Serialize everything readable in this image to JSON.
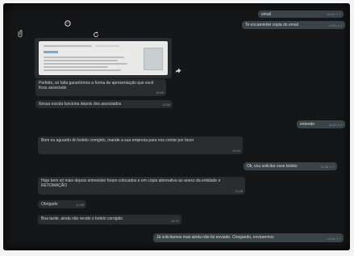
{
  "messages": [
    {
      "id": "m1",
      "side": "out",
      "text": "email",
      "time": "10:51",
      "ticks": "✓✓"
    },
    {
      "id": "m2",
      "side": "out",
      "text": "Te encaminhei cópia do email",
      "time": "10:51",
      "ticks": "✓✓"
    },
    {
      "id": "m4",
      "side": "in",
      "text": "Perfeito, só falta garantirmos a forma de apresentação que você ficou associado",
      "time": "10:56"
    },
    {
      "id": "m5",
      "side": "in",
      "text": "Nossa escola funciona depois dos associados",
      "time": "10:56"
    },
    {
      "id": "m6",
      "side": "out",
      "text": "entendo",
      "time": "11:01",
      "ticks": "✓✓"
    },
    {
      "id": "m7",
      "side": "in",
      "text": "Bom eu aguardo do boleto corrigido, mande a sua empresa para nos contar por favor",
      "time": "11:04"
    },
    {
      "id": "m8",
      "side": "out",
      "text": "Ok, vou solicitar esse boleto",
      "time": "11:05",
      "ticks": "✓✓"
    },
    {
      "id": "m9",
      "side": "in",
      "text": "Hoje bem só mais depois entrevistei foram colocados e em cópia alternativa ao anexo da entidade e RETOMAÇÃO",
      "time": "11:08"
    },
    {
      "id": "m10",
      "side": "in",
      "text": "Obrigado",
      "time": "11:08"
    },
    {
      "id": "m11",
      "side": "in",
      "text": "Boa tarde, ainda não recebi o boleto corrigido",
      "time": "14:22"
    },
    {
      "id": "m12",
      "side": "out",
      "text": "Já solicitamos mas ainda não foi enviado. Chegando, enviaremos",
      "time": "14:30",
      "ticks": "✓✓"
    }
  ],
  "icons": {
    "attach": "paperclip-icon",
    "emoji": "emoji-icon",
    "refresh": "refresh-icon",
    "forward": "forward-icon"
  },
  "colors": {
    "background": "#151618",
    "incoming": "#2a2d30",
    "outgoing": "#3a4348",
    "ticks": "#7fb4d4"
  }
}
